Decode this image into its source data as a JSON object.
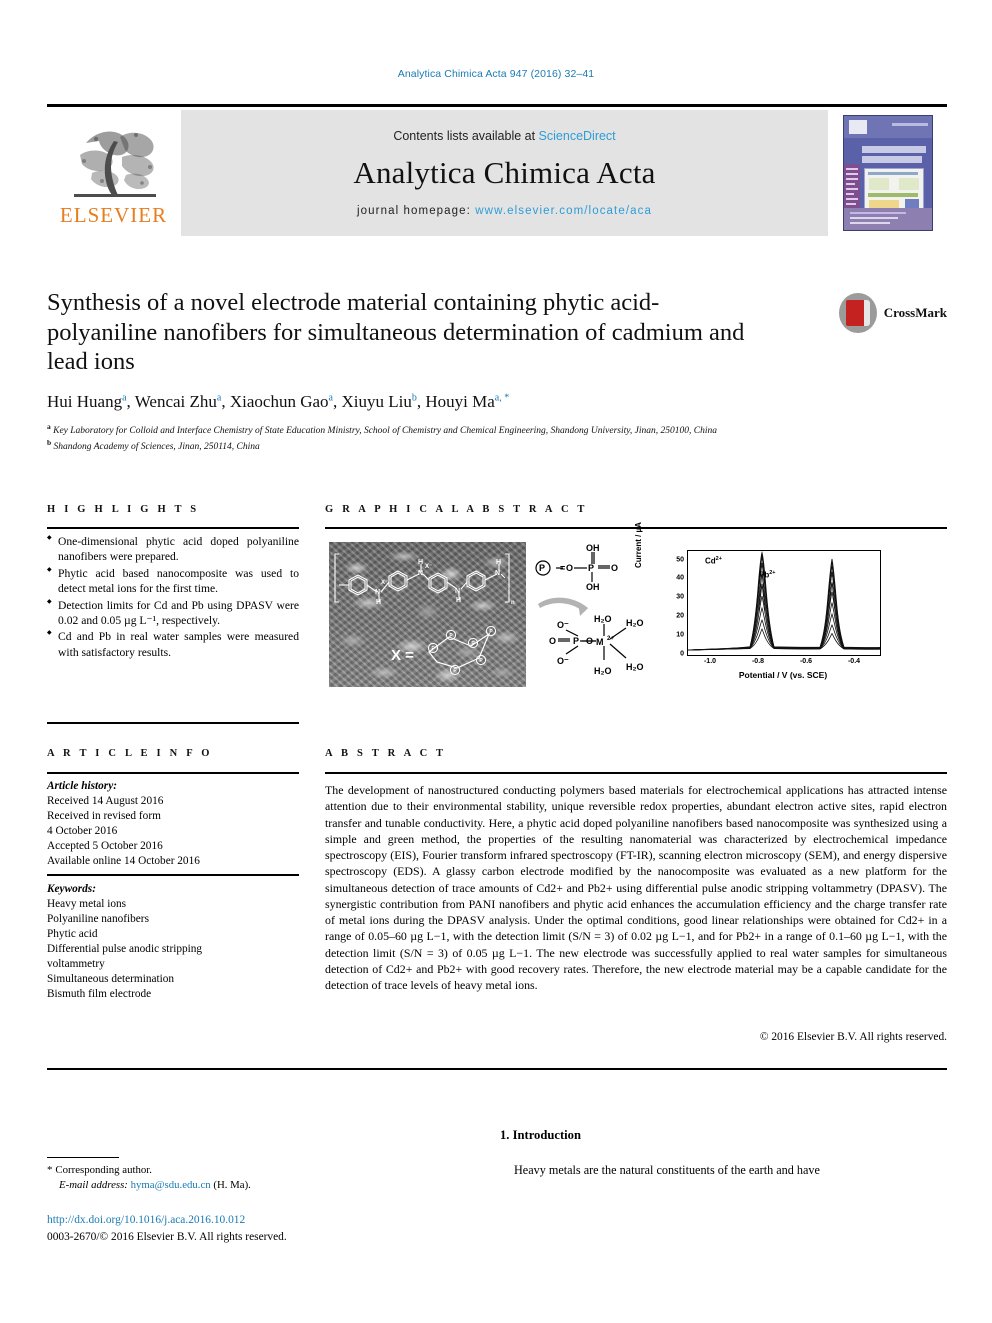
{
  "running_head": "Analytica Chimica Acta 947 (2016) 32–41",
  "masthead": {
    "publisher_logo_text": "ELSEVIER",
    "contents_prefix": "Contents lists available at ",
    "contents_link": "ScienceDirect",
    "journal_title": "Analytica Chimica Acta",
    "homepage_prefix": "journal homepage: ",
    "homepage_url": "www.elsevier.com/locate/aca"
  },
  "article": {
    "title": "Synthesis of a novel electrode material containing phytic acid-polyaniline nanofibers for simultaneous determination of cadmium and lead ions",
    "authors": [
      {
        "name": "Hui Huang",
        "sup": "a"
      },
      {
        "name": "Wencai Zhu",
        "sup": "a"
      },
      {
        "name": "Xiaochun Gao",
        "sup": "a"
      },
      {
        "name": "Xiuyu Liu",
        "sup": "b"
      },
      {
        "name": "Houyi Ma",
        "sup": "a, *"
      }
    ],
    "affiliations": [
      {
        "marker": "a",
        "text": "Key Laboratory for Colloid and Interface Chemistry of State Education Ministry, School of Chemistry and Chemical Engineering, Shandong University, Jinan, 250100, China"
      },
      {
        "marker": "b",
        "text": "Shandong Academy of Sciences, Jinan, 250114, China"
      }
    ],
    "crossmark_label": "CrossMark"
  },
  "highlights": {
    "heading": "H I G H L I G H T S",
    "items": [
      "One-dimensional phytic acid doped polyaniline nanofibers were prepared.",
      "Phytic acid based nanocomposite was used to detect metal ions for the first time.",
      "Detection limits for Cd and Pb using DPASV were 0.02 and 0.05 µg L⁻¹, respectively.",
      "Cd and Pb in real water samples were measured with satisfactory results."
    ]
  },
  "article_info": {
    "heading": "A R T I C L E   I N F O",
    "history_label": "Article history:",
    "history": [
      "Received 14 August 2016",
      "Received in revised form",
      "4 October 2016",
      "Accepted 5 October 2016",
      "Available online 14 October 2016"
    ],
    "keywords_label": "Keywords:",
    "keywords": [
      "Heavy metal ions",
      "Polyaniline nanofibers",
      "Phytic acid",
      "Differential pulse anodic stripping",
      "voltammetry",
      "Simultaneous determination",
      "Bismuth film electrode"
    ]
  },
  "graphical_abstract": {
    "heading": "G R A P H I C A L   A B S T R A C T",
    "sem_caption": "SEM micrograph of phytic acid doped polyaniline nanofibers with overlaid polymer structure",
    "polymer_x_label": "X =",
    "phosphate_legend": "P =",
    "phosphate_oh_top": "OH",
    "phosphate_oh_bottom": "OH",
    "phosphate_o_left": "O",
    "phosphate_o_right": "O",
    "complex_center": "M2+",
    "complex_waters": [
      "H2O",
      "H2O",
      "H2O",
      "H2O"
    ],
    "complex_o_left": "O",
    "complex_o_right": "O",
    "complex_o_upper": "O−",
    "complex_o_lower": "O−",
    "complex_p": "P"
  },
  "chart_data": {
    "type": "line",
    "title": "",
    "xlabel": "Potential / V (vs. SCE)",
    "ylabel": "Current / µA",
    "xlim": [
      -1.1,
      -0.3
    ],
    "ylim": [
      0,
      55
    ],
    "xticks": [
      -1.0,
      -0.8,
      -0.6,
      -0.4
    ],
    "xtick_labels": [
      "-1.0",
      "-0.8",
      "-0.6",
      "-0.4"
    ],
    "yticks": [
      0,
      10,
      20,
      30,
      40,
      50
    ],
    "ytick_labels": [
      "0",
      "10",
      "20",
      "30",
      "40",
      "50"
    ],
    "grid": false,
    "legend": "none",
    "annotations": [
      {
        "text": "Cd2+",
        "x": -0.93,
        "y": 49
      },
      {
        "text": "Pb2+",
        "x": -0.72,
        "y": 42
      }
    ],
    "peaks": [
      {
        "name": "Cd2+",
        "center": -0.8,
        "width": 0.045,
        "heights": [
          3,
          6,
          10,
          15,
          21,
          28,
          35,
          41,
          47,
          52
        ]
      },
      {
        "name": "Pb2+",
        "center": -0.6,
        "width": 0.04,
        "heights": [
          2,
          5,
          8,
          13,
          18,
          24,
          30,
          36,
          41,
          45
        ]
      }
    ],
    "baseline": 1.5,
    "series_count": 10
  },
  "abstract": {
    "heading": "A B S T R A C T",
    "paragraphs": [
      "The development of nanostructured conducting polymers based materials for electrochemical applications has attracted intense attention due to their environmental stability, unique reversible redox properties, abundant electron active sites, rapid electron transfer and tunable conductivity. Here, a phytic acid doped polyaniline nanofibers based nanocomposite was synthesized using a simple and green method, the properties of the resulting nanomaterial was characterized by electrochemical impedance spectroscopy (EIS), Fourier transform infrared spectroscopy (FT-IR), scanning electron microscopy (SEM), and energy dispersive spectroscopy (EDS). A glassy carbon electrode modified by the nanocomposite was evaluated as a new platform for the simultaneous detection of trace amounts of Cd2+ and Pb2+ using differential pulse anodic stripping voltammetry (DPASV). The synergistic contribution from PANI nanofibers and phytic acid enhances the accumulation efficiency and the charge transfer rate of metal ions during the DPASV analysis. Under the optimal conditions, good linear relationships were obtained for Cd2+ in a range of 0.05–60 µg L−1, with the detection limit (S/N = 3) of 0.02 µg L−1, and for Pb2+ in a range of 0.1–60 µg L−1, with the detection limit (S/N = 3) of 0.05 µg L−1. The new electrode was successfully applied to real water samples for simultaneous detection of Cd2+ and Pb2+ with good recovery rates. Therefore, the new electrode material may be a capable candidate for the detection of trace levels of heavy metal ions."
    ],
    "copyright": "© 2016 Elsevier B.V. All rights reserved."
  },
  "footer": {
    "corresponding_marker": "*",
    "corresponding_label": "Corresponding author.",
    "email_label": "E-mail address:",
    "email": "hyma@sdu.edu.cn",
    "email_suffix": "(H. Ma).",
    "doi": "http://dx.doi.org/10.1016/j.aca.2016.10.012",
    "issn_line": "0003-2670/© 2016 Elsevier B.V. All rights reserved."
  },
  "introduction": {
    "heading": "1.  Introduction",
    "first_line": "Heavy metals are the natural constituents of the earth and have"
  }
}
